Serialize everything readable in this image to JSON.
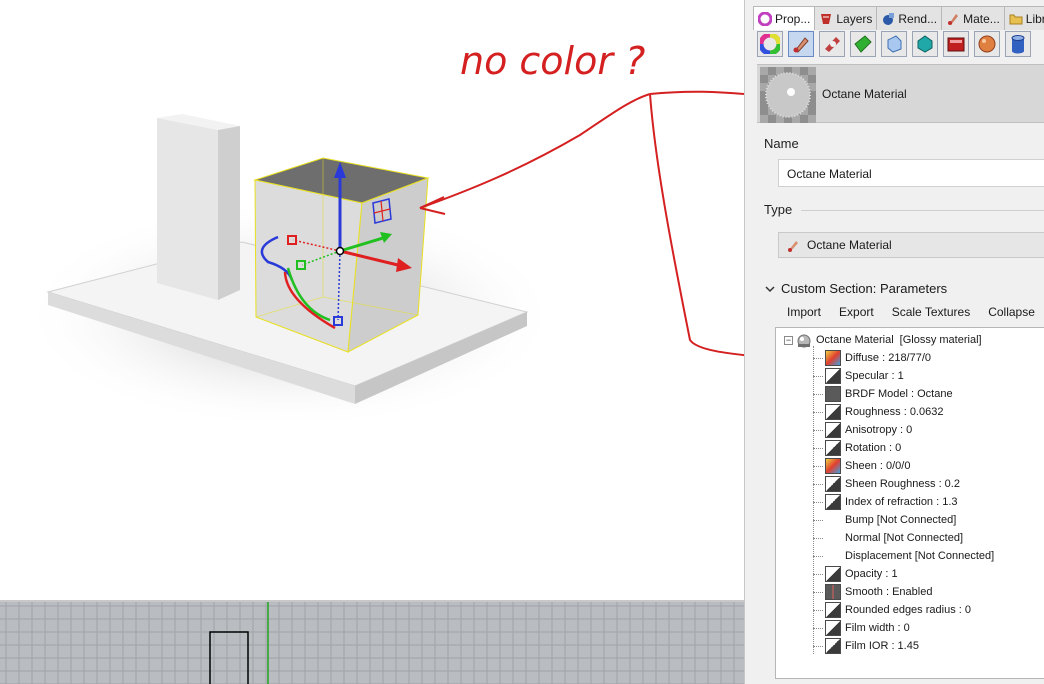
{
  "annotation": {
    "text": "no color ?"
  },
  "tabs": [
    {
      "label": "Prop...",
      "icon": "properties-icon",
      "active": true
    },
    {
      "label": "Layers",
      "icon": "layers-icon",
      "active": false
    },
    {
      "label": "Rend...",
      "icon": "render-icon",
      "active": false
    },
    {
      "label": "Mate...",
      "icon": "materials-icon",
      "active": false
    },
    {
      "label": "Libra",
      "icon": "folder-icon",
      "active": false
    }
  ],
  "toolbar": {
    "icons": [
      "color-wheel-icon",
      "material-brush-icon",
      "decal-icon",
      "texture-mapping-icon",
      "glass-icon",
      "teal-gem-icon",
      "red-box-icon",
      "ball-icon",
      "cylinder-icon"
    ],
    "selected_index": 1
  },
  "material": {
    "title": "Octane Material"
  },
  "name_section": {
    "label": "Name",
    "value": "Octane Material"
  },
  "type_section": {
    "label": "Type",
    "value": "Octane Material"
  },
  "custom_section": {
    "label": "Custom Section: Parameters"
  },
  "actions": {
    "import": "Import",
    "export": "Export",
    "scale_textures": "Scale Textures",
    "collapse": "Collapse"
  },
  "tree": {
    "root": {
      "label": "Octane Material",
      "kind": "[Glossy material]"
    },
    "items": [
      {
        "label": "Diffuse : 218/77/0",
        "icon": "color-icon"
      },
      {
        "label": "Specular : 1",
        "icon": "float-icon"
      },
      {
        "label": "BRDF Model : Octane",
        "icon": "enum-icon"
      },
      {
        "label": "Roughness : 0.0632",
        "icon": "float-icon"
      },
      {
        "label": "Anisotropy : 0",
        "icon": "float-icon"
      },
      {
        "label": "Rotation : 0",
        "icon": "float-icon"
      },
      {
        "label": "Sheen : 0/0/0",
        "icon": "color-icon"
      },
      {
        "label": "Sheen Roughness : 0.2",
        "icon": "float-icon"
      },
      {
        "label": "Index of refraction : 1.3",
        "icon": "float-icon"
      },
      {
        "label": "Bump  [Not Connected]",
        "icon": ""
      },
      {
        "label": "Normal  [Not Connected]",
        "icon": ""
      },
      {
        "label": "Displacement  [Not Connected]",
        "icon": ""
      },
      {
        "label": "Opacity : 1",
        "icon": "float-icon"
      },
      {
        "label": "Smooth : Enabled",
        "icon": "bool-icon"
      },
      {
        "label": "Rounded edges radius : 0",
        "icon": "float-icon"
      },
      {
        "label": "Film width : 0",
        "icon": "float-icon"
      },
      {
        "label": "Film IOR : 1.45",
        "icon": "float-icon"
      }
    ]
  },
  "colors": {
    "annotation_red": "#d42020",
    "selection_yellow": "#e8e020",
    "panel_bg": "#f0f0f0"
  }
}
